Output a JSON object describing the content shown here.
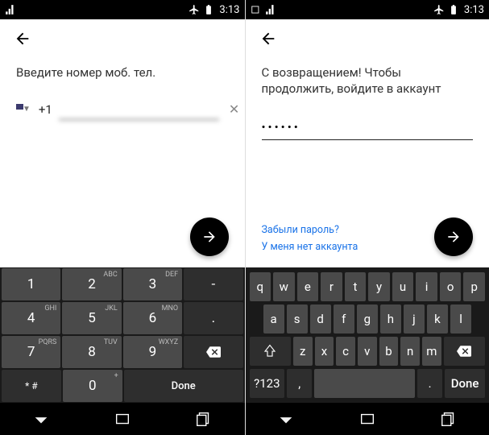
{
  "status": {
    "time": "3:13"
  },
  "left": {
    "prompt": "Введите номер моб. тел.",
    "dial_prefix": "+1",
    "phone_blur": " ",
    "clear": "✕"
  },
  "right": {
    "prompt": "С возвращением! Чтобы продолжить, войдите в аккаунт",
    "password_dots": "••••••",
    "forgot": "Забыли пароль?",
    "no_account": "У меня нет аккаунта"
  },
  "numkbd": {
    "r1": [
      {
        "n": "1",
        "s": ""
      },
      {
        "n": "2",
        "s": "ABC"
      },
      {
        "n": "3",
        "s": "DEF"
      },
      {
        "n": "-",
        "s": ""
      }
    ],
    "r2": [
      {
        "n": "4",
        "s": "GHI"
      },
      {
        "n": "5",
        "s": "JKL"
      },
      {
        "n": "6",
        "s": "MNO"
      },
      {
        "n": ".",
        "s": ""
      }
    ],
    "r3": [
      {
        "n": "7",
        "s": "PQRS"
      },
      {
        "n": "8",
        "s": "TUV"
      },
      {
        "n": "9",
        "s": "WXYZ"
      }
    ],
    "r4": [
      {
        "n": "* #"
      },
      {
        "n": "0",
        "s": "+"
      }
    ],
    "done": "Done"
  },
  "qkbd": {
    "r1": [
      "q",
      "w",
      "e",
      "r",
      "t",
      "y",
      "u",
      "i",
      "o",
      "p"
    ],
    "r2": [
      "a",
      "s",
      "d",
      "f",
      "g",
      "h",
      "j",
      "k",
      "l"
    ],
    "r3": [
      "z",
      "x",
      "c",
      "v",
      "b",
      "n",
      "m"
    ],
    "sym": "?123",
    "comma": ",",
    "dot": ".",
    "done": "Done"
  }
}
